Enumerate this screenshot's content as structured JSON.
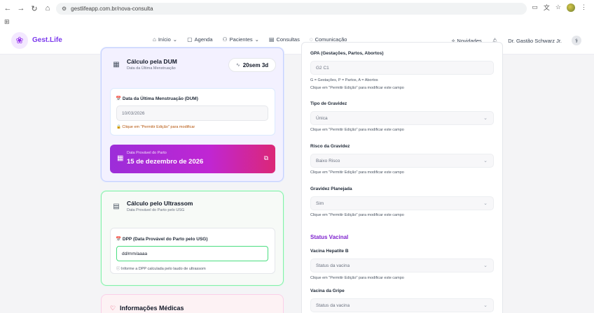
{
  "browser": {
    "url": "gestlifeapp.com.br/nova-consulta",
    "back_icon": "←",
    "forward_icon": "→",
    "reload_icon": "↻",
    "home_icon": "⌂"
  },
  "header": {
    "brand": "Gest.Life",
    "menu": [
      {
        "icon": "⌂",
        "label": "Início",
        "chevron": "⌄"
      },
      {
        "icon": "▢",
        "label": "Agenda",
        "chevron": ""
      },
      {
        "icon": "⚇",
        "label": "Pacientes",
        "chevron": "⌄"
      },
      {
        "icon": "▤",
        "label": "Consultas",
        "chevron": ""
      },
      {
        "icon": "◌",
        "label": "Comunicação",
        "chevron": ""
      }
    ],
    "news_label": "Novidades",
    "user_name": "Dr. Gastão Schwarz Jr."
  },
  "dum_card": {
    "title": "Cálculo pela DUM",
    "subtitle": "Data da Última Menstruação",
    "weeks": "20sem 3d",
    "field_label": "📅 Data da Última Menstruação (DUM)",
    "field_value": "10/03/2026",
    "hint": "🔒 Clique em \"Permitir Edição\" para modificar",
    "dpp_label": "Data Provável do Parto",
    "dpp_value": "15 de dezembro de 2026"
  },
  "usg_card": {
    "title": "Cálculo pelo Ultrassom",
    "subtitle": "Data Provável do Parto pelo USG",
    "field_label": "📅 DPP (Data Provável do Parto pelo USG)",
    "field_value": "dd/mm/aaaa",
    "hint": "ⓘ Informe a DPP calculada pelo laudo de ultrassom"
  },
  "medical_card": {
    "title": "Informações Médicas"
  },
  "right_panel": {
    "gpa_label": "GPA (Gestações, Partos, Abortos)",
    "gpa_value": "G2 C1",
    "gpa_legend": "G = Gestações, P = Partos, A = Abortos",
    "edit_hint": "Clique em \"Permitir Edição\" para modificar este campo",
    "pregnancy_type_label": "Tipo de Gravidez",
    "pregnancy_type_value": "Única",
    "risk_label": "Risco da Gravidez",
    "risk_value": "Baixo Risco",
    "planned_label": "Gravidez Planejada",
    "planned_value": "Sim",
    "vaccine_section": "Status Vacinal",
    "hep_b_label": "Vacina Hepatite B",
    "hep_b_value": "Status da vacina",
    "flu_label": "Vacina da Gripe",
    "flu_value": "Status da vacina"
  }
}
